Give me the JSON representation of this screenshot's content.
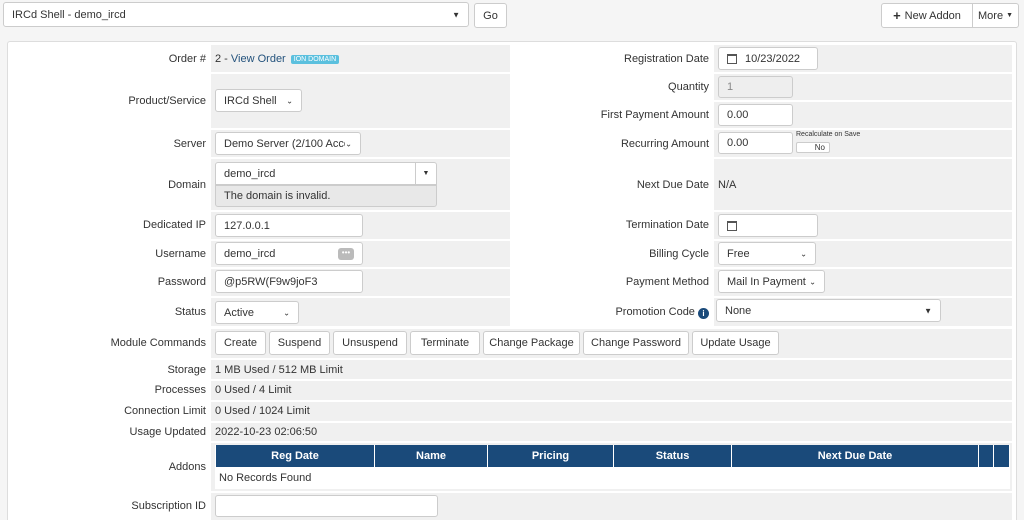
{
  "topbar": {
    "service_select": "IRCd Shell - demo_ircd",
    "go_label": "Go",
    "new_addon_label": "New Addon",
    "more_label": "More"
  },
  "left": {
    "order_label": "Order #",
    "order_number": "2 - ",
    "order_link": "View Order",
    "order_badge": "ION DOMAIN",
    "product_label": "Product/Service",
    "product_value": "IRCd Shell",
    "server_label": "Server",
    "server_value": "Demo Server (2/100 Acco",
    "domain_label": "Domain",
    "domain_value": "demo_ircd",
    "domain_error": "The domain is invalid.",
    "dedicated_ip_label": "Dedicated IP",
    "dedicated_ip_value": "127.0.0.1",
    "username_label": "Username",
    "username_value": "demo_ircd",
    "password_label": "Password",
    "password_value": "@p5RW(F9w9joF3",
    "status_label": "Status",
    "status_value": "Active"
  },
  "right": {
    "reg_date_label": "Registration Date",
    "reg_date_value": "10/23/2022",
    "quantity_label": "Quantity",
    "quantity_value": "1",
    "first_payment_label": "First Payment Amount",
    "first_payment_value": "0.00",
    "recurring_label": "Recurring Amount",
    "recurring_value": "0.00",
    "recalculate_label": "Recalculate on Save",
    "recalculate_toggle": "No",
    "next_due_label": "Next Due Date",
    "next_due_value": "N/A",
    "termination_label": "Termination Date",
    "billing_cycle_label": "Billing Cycle",
    "billing_cycle_value": "Free",
    "payment_method_label": "Payment Method",
    "payment_method_value": "Mail In Payment",
    "promo_label": "Promotion Code",
    "promo_value": "None"
  },
  "module": {
    "label": "Module Commands",
    "buttons": [
      "Create",
      "Suspend",
      "Unsuspend",
      "Terminate",
      "Change Package",
      "Change Password",
      "Update Usage"
    ]
  },
  "usage": {
    "storage_label": "Storage",
    "storage_value": "1 MB Used / 512 MB Limit",
    "processes_label": "Processes",
    "processes_value": "0 Used / 4 Limit",
    "connection_label": "Connection Limit",
    "connection_value": "0 Used / 1024 Limit",
    "updated_label": "Usage Updated",
    "updated_value": "2022-10-23 02:06:50"
  },
  "addons": {
    "label": "Addons",
    "columns": [
      "Reg Date",
      "Name",
      "Pricing",
      "Status",
      "Next Due Date"
    ],
    "empty": "No Records Found"
  },
  "subscription": {
    "label": "Subscription ID",
    "value": ""
  }
}
